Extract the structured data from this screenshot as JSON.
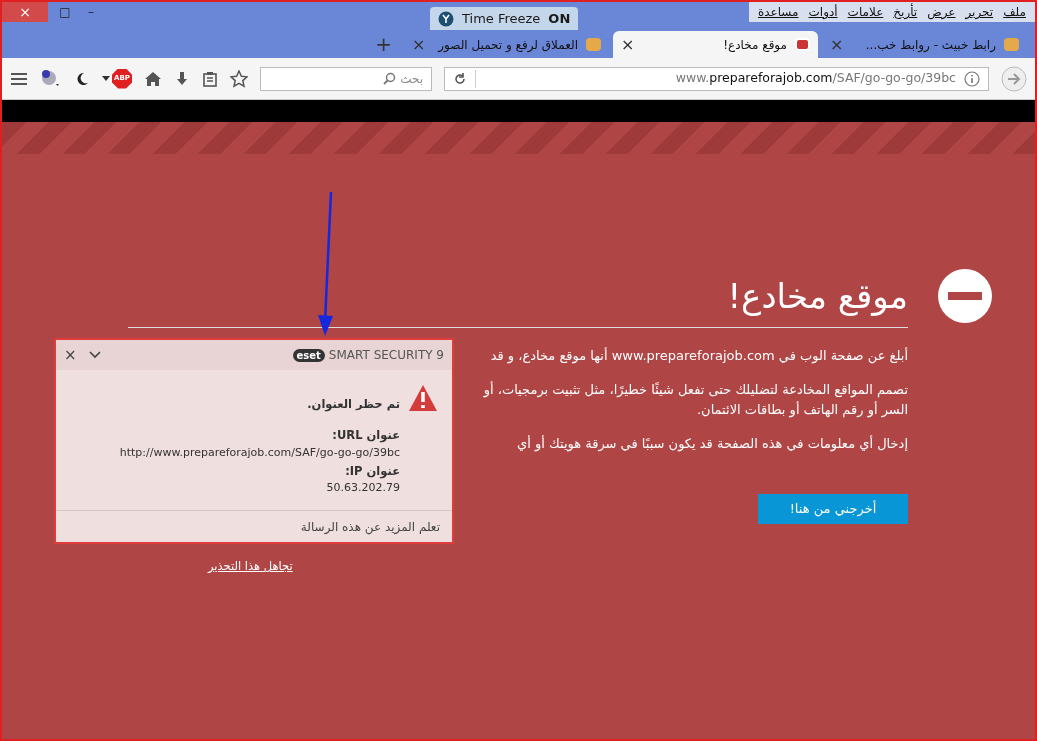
{
  "window": {
    "close": "×",
    "restore": "□",
    "minimize": "–"
  },
  "time_freeze": {
    "label": "Time Freeze",
    "state": "ON",
    "on": true
  },
  "menu": [
    "ملف",
    "تحرير",
    "عرض",
    "تأريخ",
    "علامات",
    "أدوات",
    "مساعدة"
  ],
  "tabs": [
    {
      "title": "رابط خبيث - روابط خب...",
      "close": "×",
      "selected": false
    },
    {
      "title": "موقع مخادع!",
      "close": "×",
      "selected": true
    },
    {
      "title": "العملاق لرفع و تحميل الصور",
      "close": "×",
      "selected": false
    }
  ],
  "new_tab": "+",
  "adblock": {
    "label": "ABP"
  },
  "url": {
    "prefix": "www.",
    "domain": "prepareforajob.com",
    "path": "/SAF/go-go-go/39bc"
  },
  "search": {
    "placeholder": "بحث"
  },
  "page": {
    "title": "موقع مخادع!",
    "paragraphs": [
      [
        "أبلغ عن صفحة الوب في www.prepareforajob.com أنها موقع مخادع، و قد"
      ],
      [
        "تصمم المواقع المخادعة لتضليلك حتى تفعل شيئًا خطيرًا، مثل تثبيت برمجيات، أو",
        "السر أو رقم الهاتف أو بطاقات الائتمان."
      ],
      [
        "إدخال أي معلومات في هذه الصفحة قد يكون سببًا في سرقة هويتك أو أي"
      ]
    ],
    "get_out_button": "أخرجني من هنا!",
    "ignore_link": "تجاهل هذا التحذير"
  },
  "eset_popup": {
    "brand": "eset",
    "product": "SMART SECURITY 9",
    "close": "×",
    "message": "تم حظر العنوان.",
    "url_label": "عنوان URL:",
    "url": "http://www.prepareforajob.com/SAF/go-go-go/39bc",
    "ip_label": "عنوان IP:",
    "ip": "50.63.202.79",
    "footer_link": "تعلم المزيد عن هذه الرسالة"
  }
}
